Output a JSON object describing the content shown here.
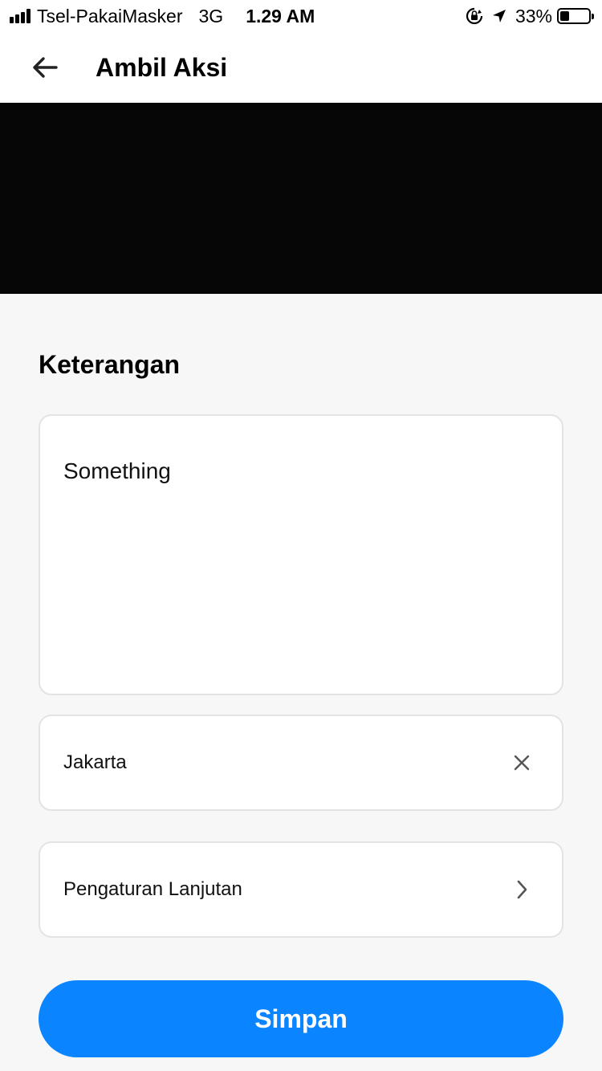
{
  "status_bar": {
    "carrier": "Tsel-PakaiMasker",
    "network": "3G",
    "time": "1.29 AM",
    "battery_percent": "33%",
    "battery_level": 0.33,
    "signal_bars": 4
  },
  "header": {
    "back_icon": "arrow-left-icon",
    "title": "Ambil Aksi"
  },
  "form": {
    "section_title": "Keterangan",
    "description_value": "Something",
    "location_value": "Jakarta",
    "clear_icon": "close-icon",
    "advanced_label": "Pengaturan Lanjutan",
    "advanced_icon": "chevron-right-icon",
    "save_label": "Simpan"
  },
  "colors": {
    "primary": "#0a84ff",
    "background": "#f7f7f7",
    "card_border": "#e3e3e3",
    "camera_preview": "#060606"
  }
}
